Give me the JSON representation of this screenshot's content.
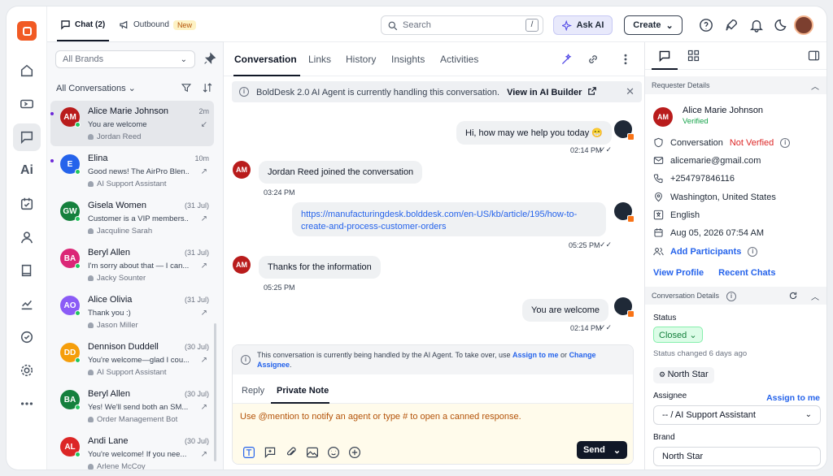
{
  "sidebar": {
    "ai_label": "Ai"
  },
  "list": {
    "tab_chat": "Chat (2)",
    "tab_outbound": "Outbound",
    "new_badge": "New",
    "brand_select": "All Brands",
    "all_conversations": "All Conversations",
    "items": [
      {
        "initials": "AM",
        "color": "#b91c1c",
        "name": "Alice Marie Johnson",
        "time": "2m",
        "message": "You are welcome",
        "agent": "Jordan Reed"
      },
      {
        "initials": "E",
        "color": "#2563eb",
        "name": "Elina",
        "time": "10m",
        "message": "Good news! The AirPro Blen...",
        "agent": "AI Support Assistant"
      },
      {
        "initials": "GW",
        "color": "#15803d",
        "name": "Gisela Women",
        "time": "(31 Jul)",
        "message": "Customer is a VIP members...",
        "agent": "Jacquline Sarah"
      },
      {
        "initials": "BA",
        "color": "#db2777",
        "name": "Beryl Allen",
        "time": "(31 Jul)",
        "message": "I'm sorry about that — I can...",
        "agent": "Jacky Sounter"
      },
      {
        "initials": "AO",
        "color": "#8b5cf6",
        "name": "Alice Olivia",
        "time": "(31 Jul)",
        "message": "Thank you :)",
        "agent": "Jason Miller"
      },
      {
        "initials": "DD",
        "color": "#f59e0b",
        "name": "Dennison Duddell",
        "time": "(30 Jul)",
        "message": "You're welcome—glad I cou...",
        "agent": "AI Support Assistant"
      },
      {
        "initials": "BA",
        "color": "#15803d",
        "name": "Beryl Allen",
        "time": "(30 Jul)",
        "message": "Yes! We'll send both an SM...",
        "agent": "Order Management Bot"
      },
      {
        "initials": "AL",
        "color": "#dc2626",
        "name": "Andi Lane",
        "time": "(30 Jul)",
        "message": "You're welcome! If you nee...",
        "agent": "Arlene McCoy"
      }
    ]
  },
  "topbar": {
    "search_placeholder": "Search",
    "slash": "/",
    "ask_ai": "Ask AI",
    "create": "Create"
  },
  "main": {
    "tabs": [
      "Conversation",
      "Links",
      "History",
      "Insights",
      "Activities"
    ],
    "banner_text": "BoldDesk 2.0 AI Agent is currently handling this conversation.",
    "banner_link": "View in AI Builder",
    "messages": [
      {
        "text": "Hi, how may we help you today 😁",
        "time": "02:14 PM"
      },
      {
        "text": "Jordan Reed joined the conversation",
        "time": "03:24 PM"
      },
      {
        "text": "https://manufacturingdesk.bolddesk.com/en-US/kb/article/195/how-to-create-and-process-customer-orders",
        "time": "05:25 PM"
      },
      {
        "text": "Thanks for the information",
        "time": "05:25 PM"
      },
      {
        "text": "You are welcome",
        "time": "02:14 PM"
      }
    ],
    "customer_initials": "AM",
    "ai_note_text": "This conversation is currently being handled by the AI Agent. To take over, use ",
    "ai_note_link1": "Assign to me",
    "ai_note_or": " or ",
    "ai_note_link2": "Change Assignee",
    "ai_note_end": ".",
    "reply_tab": "Reply",
    "private_tab": "Private Note",
    "editor_placeholder": "Use @mention to notify an agent or type # to open a canned response.",
    "send": "Send"
  },
  "details": {
    "requester_header": "Requester Details",
    "initials": "AM",
    "name": "Alice Marie Johnson",
    "verified": "Verified",
    "conv_label": "Conversation",
    "not_verified": "Not Verfied",
    "email": "alicemarie@gmail.com",
    "phone": "+254797846116",
    "location": "Washington, United States",
    "language": "English",
    "date": "Aug 05, 2026 07:54 AM",
    "add_participants": "Add Participants",
    "view_profile": "View Profile",
    "recent_chats": "Recent Chats",
    "conv_details_header": "Conversation Details",
    "status_label": "Status",
    "status_value": "Closed",
    "status_changed": "Status changed 6 days ago",
    "brand_tag": "North Star",
    "assignee_label": "Assignee",
    "assign_to_me": "Assign to me",
    "assignee_value": "-- / AI Support Assistant",
    "brand_label": "Brand",
    "brand_value": "North Star"
  }
}
